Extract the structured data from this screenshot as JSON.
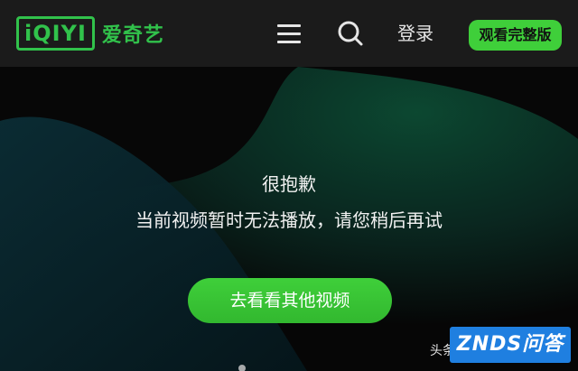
{
  "header": {
    "logo_mark": "iQIYI",
    "logo_name": "爱奇艺",
    "login_label": "登录",
    "full_version_label": "观看完整版"
  },
  "message": {
    "title": "很抱歉",
    "body": "当前视频暂时无法播放，请您稍后再试"
  },
  "cta": {
    "label": "去看看其他视频"
  },
  "watermarks": {
    "toutiao": "头条",
    "znds": "ZNDS问答"
  },
  "colors": {
    "brand_green": "#31c24b",
    "button_green": "#3fcf3a",
    "header_bg": "#1b1b1b",
    "watermark_blue": "#1f7fe0"
  },
  "icons": {
    "menu": "hamburger-menu-icon",
    "search": "search-icon"
  }
}
